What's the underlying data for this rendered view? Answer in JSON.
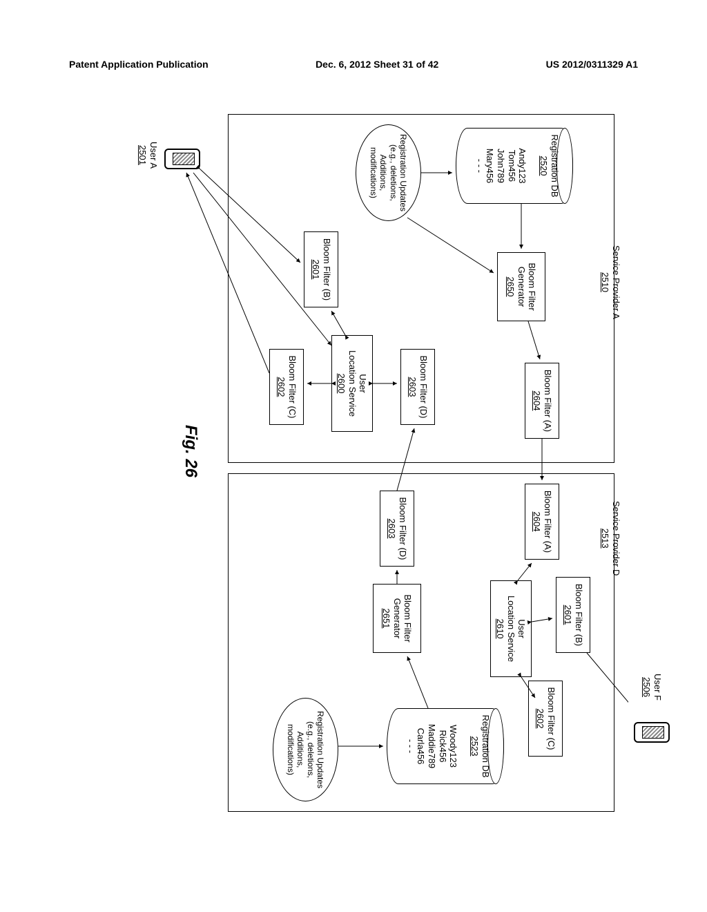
{
  "header": {
    "left": "Patent Application Publication",
    "center": "Dec. 6, 2012  Sheet 31 of 42",
    "right": "US 2012/0311329 A1"
  },
  "figure_label": "Fig. 26",
  "provider_a": {
    "title": "Service Provider A",
    "ref": "2510",
    "db": {
      "title": "Registration DB",
      "ref": "2520",
      "rows": [
        "Andy123",
        "Tom456",
        "John789",
        "Mary456",
        "- - -"
      ]
    },
    "bfgen": {
      "title": "Bloom Filter\nGenerator",
      "ref": "2650"
    },
    "bfa": {
      "title": "Bloom Filter (A)",
      "ref": "2604"
    },
    "updates": {
      "title": "Registration Updates",
      "sub": "(e.g., deletions,\nAdditions,\nmodifications)"
    },
    "bfb": {
      "title": "Bloom Filter (B)",
      "ref": "2601"
    },
    "bfd": {
      "title": "Bloom Filter (D)",
      "ref": "2603"
    },
    "uls": {
      "title": "User\nLocation Service",
      "ref": "2600"
    },
    "bfc": {
      "title": "Bloom Filter (C)",
      "ref": "2602"
    }
  },
  "provider_d": {
    "title": "Service Provider D",
    "ref": "2513",
    "bfa": {
      "title": "Bloom Filter (A)",
      "ref": "2604"
    },
    "bfb": {
      "title": "Bloom Filter (B)",
      "ref": "2601"
    },
    "bfc": {
      "title": "Bloom Filter (C)",
      "ref": "2602"
    },
    "uls": {
      "title": "User\nLocation Service",
      "ref": "2610"
    },
    "db": {
      "title": "Registration DB",
      "ref": "2523",
      "rows": [
        "Woody123",
        "Rick456",
        "Maddie789",
        "Carla456",
        "- - -"
      ]
    },
    "bfgen": {
      "title": "Bloom Filter\nGenerator",
      "ref": "2651"
    },
    "bfd": {
      "title": "Bloom Filter (D)",
      "ref": "2603"
    },
    "updates": {
      "title": "Registration Updates",
      "sub": "(e.g., deletions,\nAdditions,\nmodifications)"
    }
  },
  "users": {
    "a": {
      "title": "User A",
      "ref": "2501"
    },
    "f": {
      "title": "User F",
      "ref": "2506"
    }
  }
}
